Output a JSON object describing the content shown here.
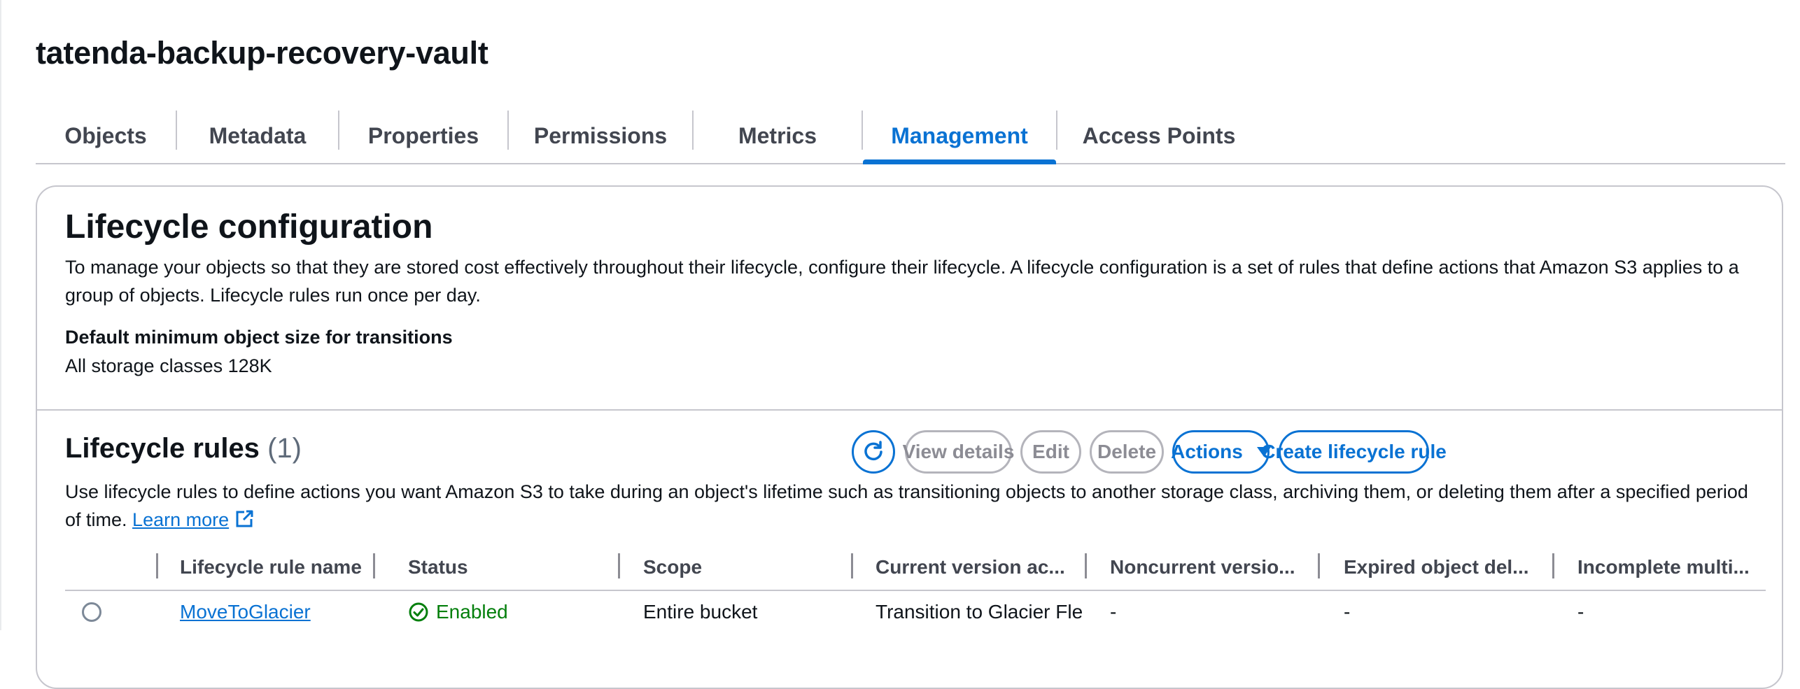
{
  "bucket": {
    "title": "tatenda-backup-recovery-vault"
  },
  "tabs": [
    {
      "label": "Objects"
    },
    {
      "label": "Metadata"
    },
    {
      "label": "Properties"
    },
    {
      "label": "Permissions"
    },
    {
      "label": "Metrics"
    },
    {
      "label": "Management"
    },
    {
      "label": "Access Points"
    }
  ],
  "active_tab": "Management",
  "lifecycle": {
    "heading": "Lifecycle configuration",
    "description": "To manage your objects so that they are stored cost effectively throughout their lifecycle, configure their lifecycle. A lifecycle configuration is a set of rules that define actions that Amazon S3 applies to a group of objects. Lifecycle rules run once per day.",
    "min_size_label": "Default minimum object size for transitions",
    "min_size_value": "All storage classes 128K"
  },
  "rules": {
    "heading": "Lifecycle rules",
    "count": "(1)",
    "description": "Use lifecycle rules to define actions you want Amazon S3 to take during an object's lifetime such as transitioning objects to another storage class, archiving them, or deleting them after a specified period of time.",
    "learn_more": "Learn more",
    "buttons": {
      "view_details": "View details",
      "edit": "Edit",
      "delete": "Delete",
      "actions": "Actions",
      "create": "Create lifecycle rule"
    },
    "columns": [
      "Lifecycle rule name",
      "Status",
      "Scope",
      "Current version ac...",
      "Noncurrent versio...",
      "Expired object del...",
      "Incomplete multi..."
    ],
    "rows": [
      {
        "name": "MoveToGlacier",
        "status": "Enabled",
        "scope": "Entire bucket",
        "current_version": "Transition to Glacier Fle",
        "noncurrent_version": "-",
        "expired_object": "-",
        "incomplete_multipart": "-"
      }
    ]
  },
  "colors": {
    "accent": "#0972d3",
    "success": "#037f0c",
    "border": "#c6c6cd",
    "text": "#0f141a"
  },
  "icons": {
    "refresh": "refresh-icon",
    "external": "external-link-icon",
    "status_ok": "check-circle-icon"
  }
}
